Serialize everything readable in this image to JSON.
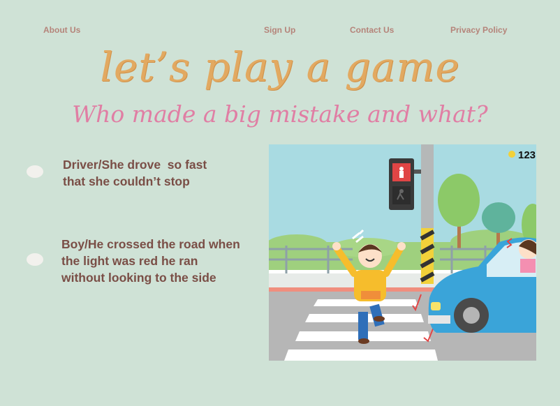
{
  "nav": {
    "about": "About Us",
    "signup": "Sign Up",
    "contact": "Contact Us",
    "privacy": "Privacy Policy"
  },
  "title": "let’s play a game",
  "subtitle": "Who made a big mistake and what?",
  "answers": [
    {
      "line1": "Driver/She drove  so fast",
      "line2": "that she couldn’t stop",
      "line3": ""
    },
    {
      "line1": "Boy/He crossed the road when",
      "line2": "the light was red he ran",
      "line3": "without looking to the side"
    }
  ],
  "illustration": {
    "badge": "123",
    "description_icon": "street-crossing-illustration"
  },
  "colors": {
    "background": "#cfe2d6",
    "title": "#e2a961",
    "subtitle": "#e07ea4",
    "answer_text": "#7a4e46",
    "nav_text": "#b5847a"
  }
}
